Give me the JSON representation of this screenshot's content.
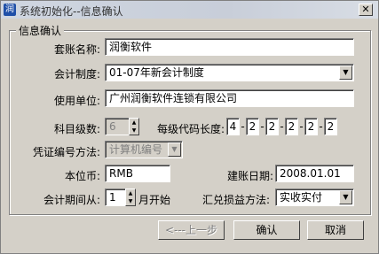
{
  "window": {
    "title": "系统初始化--信息确认",
    "close_symbol": "✕"
  },
  "group_title": "信息确认",
  "form": {
    "account_name": {
      "label": "套账名称:",
      "value": "润衡软件"
    },
    "accounting_system": {
      "label": "会计制度:",
      "value": "01-07年新会计制度"
    },
    "company": {
      "label": "使用单位:",
      "value": "广州润衡软件连锁有限公司"
    },
    "subject_levels": {
      "label": "科目级数:",
      "value": "6"
    },
    "code_length": {
      "label": "每级代码长度:",
      "segments": [
        "4",
        "2",
        "2",
        "2",
        "2",
        "2"
      ]
    },
    "voucher_method": {
      "label": "凭证编号方法:",
      "value": "计算机编号"
    },
    "currency": {
      "label": "本位币:",
      "value": "RMB"
    },
    "setup_date": {
      "label": "建账日期:",
      "value": "2008.01.01"
    },
    "period_start": {
      "label": "会计期间从:",
      "value": "1",
      "suffix": "月开始"
    },
    "exchange_method": {
      "label": "汇兑损益方法:",
      "value": "实收实付"
    }
  },
  "buttons": {
    "prev": "<---上一步",
    "confirm": "确认",
    "cancel": "取消"
  }
}
